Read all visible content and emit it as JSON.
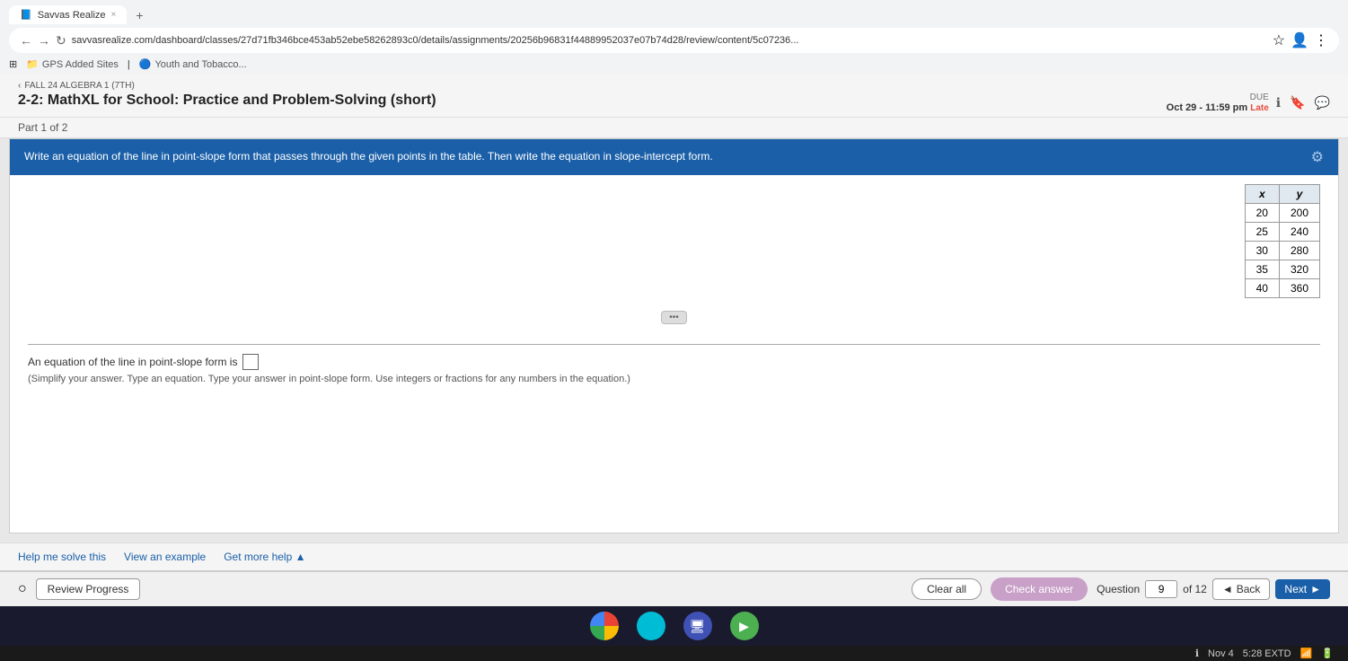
{
  "browser": {
    "tab_title": "Savvas Realize",
    "tab_close": "×",
    "tab_plus": "+",
    "nav_back": "←",
    "nav_forward": "→",
    "nav_refresh": "↻",
    "url": "savvasrealize.com/dashboard/classes/27d71fb346bce453ab52ebe58262893c0/details/assignments/20256b96831f44889952037e07b74d28/review/content/5c07236...",
    "bookmarks": [
      "GPS Added Sites",
      "Youth and Tobacco..."
    ]
  },
  "assignment": {
    "breadcrumb_label": "FALL 24 ALGEBRA 1 (7TH)",
    "title": "2-2: MathXL for School: Practice and Problem-Solving (short)",
    "part": "Part 1 of 2",
    "due_label": "DUE",
    "due_date": "Oct 29 - 11:59 pm",
    "late_badge": "Late"
  },
  "question": {
    "header_text": "Write an equation of the line in point-slope form that passes through the given points in the table. Then write the equation in slope-intercept form.",
    "settings_icon": "⚙",
    "table_headers": [
      "x",
      "y"
    ],
    "table_rows": [
      [
        "20",
        "200"
      ],
      [
        "25",
        "240"
      ],
      [
        "30",
        "280"
      ],
      [
        "35",
        "320"
      ],
      [
        "40",
        "360"
      ]
    ],
    "answer_prefix": "An equation of the line in point-slope form is",
    "answer_note": "(Simplify your answer. Type an equation. Type your answer in point-slope form. Use integers or fractions for any numbers in the equation.)"
  },
  "help": {
    "help_link": "Help me solve this",
    "example_link": "View an example",
    "more_help_link": "Get more help ▲"
  },
  "controls": {
    "review_progress": "Review Progress",
    "clear_all": "Clear all",
    "check_answer": "Check answer",
    "question_label": "Question",
    "question_num": "9",
    "question_total": "of 12",
    "back_btn": "◄ Back",
    "next_btn": "Next ►"
  },
  "taskbar": {
    "icons": [
      "chrome",
      "circle",
      "monitor",
      "play"
    ]
  },
  "system_tray": {
    "info_icon": "ℹ",
    "date": "Nov 4",
    "time": "5:28 EXTD"
  }
}
